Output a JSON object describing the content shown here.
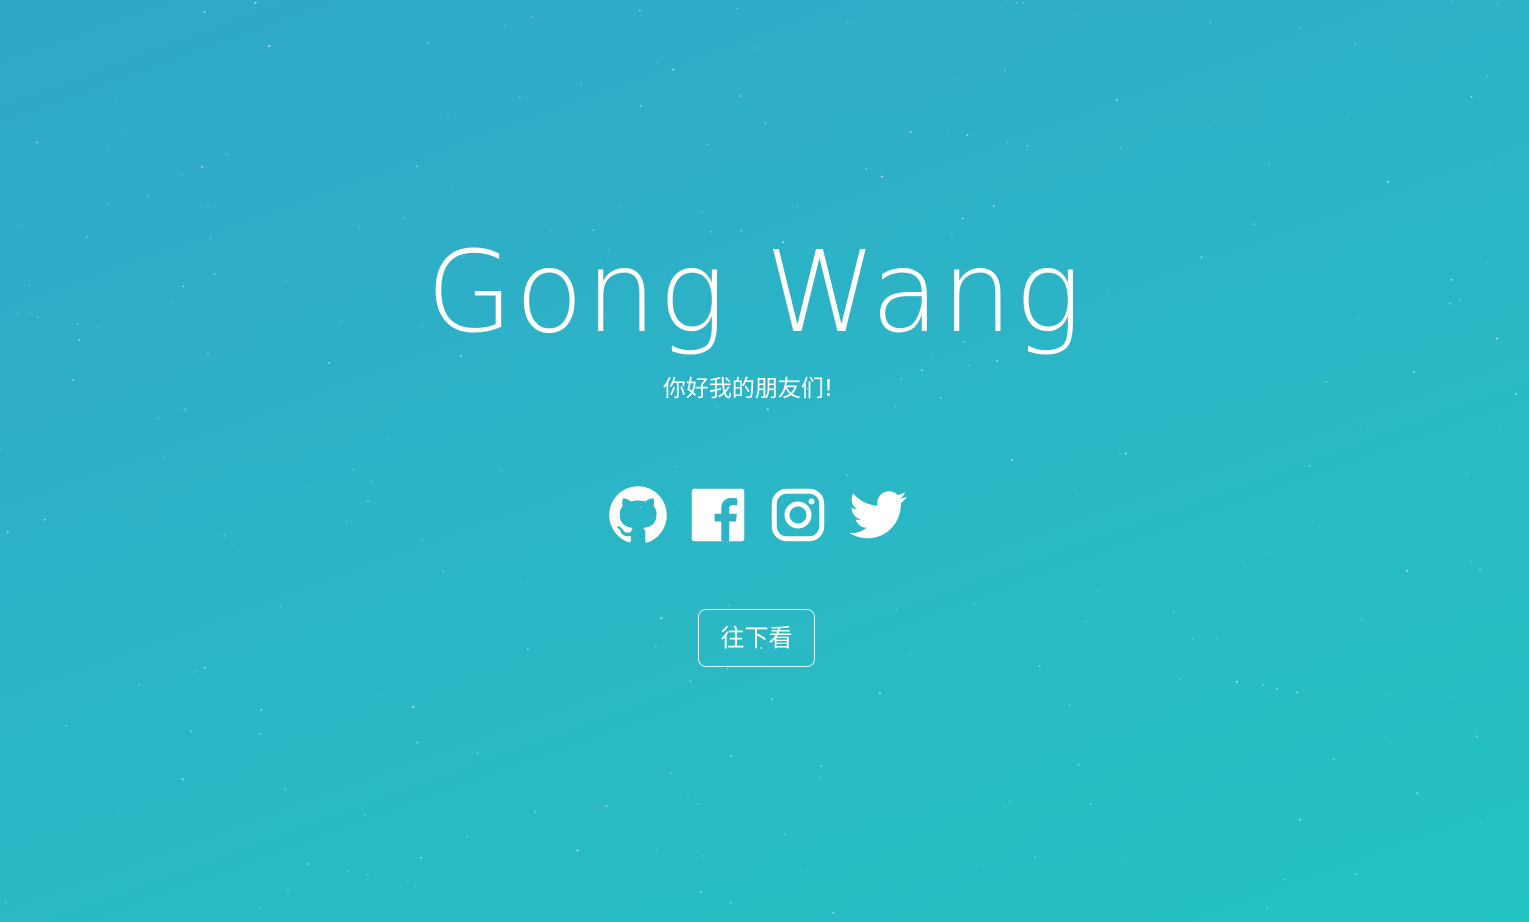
{
  "hero": {
    "title": "Gong Wang",
    "subtitle": "你好我的朋友们!",
    "scroll_button_label": "往下看"
  },
  "socials": [
    {
      "name": "github",
      "icon": "github-icon"
    },
    {
      "name": "facebook",
      "icon": "facebook-icon"
    },
    {
      "name": "instagram",
      "icon": "instagram-icon"
    },
    {
      "name": "twitter",
      "icon": "twitter-icon"
    }
  ],
  "colors": {
    "gradient_start": "#30a6c8",
    "gradient_end": "#24c3c3",
    "foreground": "#ffffff"
  }
}
